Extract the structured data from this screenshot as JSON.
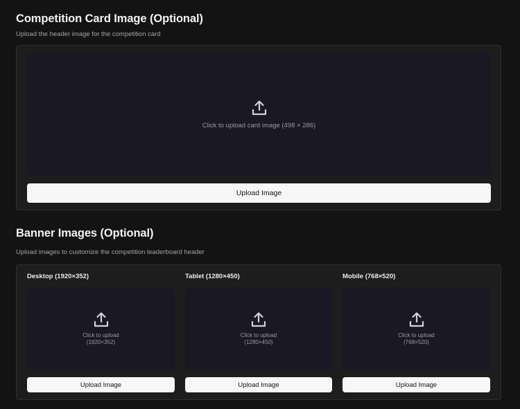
{
  "card_section": {
    "title": "Competition Card Image (Optional)",
    "subtitle": "Upload the header image for the competition card",
    "dropzone_text": "Click to upload card image (498 × 286)",
    "button_label": "Upload Image"
  },
  "banner_section": {
    "title": "Banner Images (Optional)",
    "subtitle": "Upload images to customize the competition leaderboard header",
    "columns": [
      {
        "label": "Desktop (1920×352)",
        "line1": "Click to upload",
        "line2": "(1920×352)",
        "button_label": "Upload Image"
      },
      {
        "label": "Tablet (1280×450)",
        "line1": "Click to upload",
        "line2": "(1280×450)",
        "button_label": "Upload Image"
      },
      {
        "label": "Mobile (768×520)",
        "line1": "Click to upload",
        "line2": "(768×520)",
        "button_label": "Upload Image"
      }
    ]
  },
  "icons": {
    "upload": "upload-icon"
  },
  "colors": {
    "background": "#131313",
    "panel": "#1d1d1e",
    "dropzone": "#191824",
    "button": "#f7f7f7"
  }
}
